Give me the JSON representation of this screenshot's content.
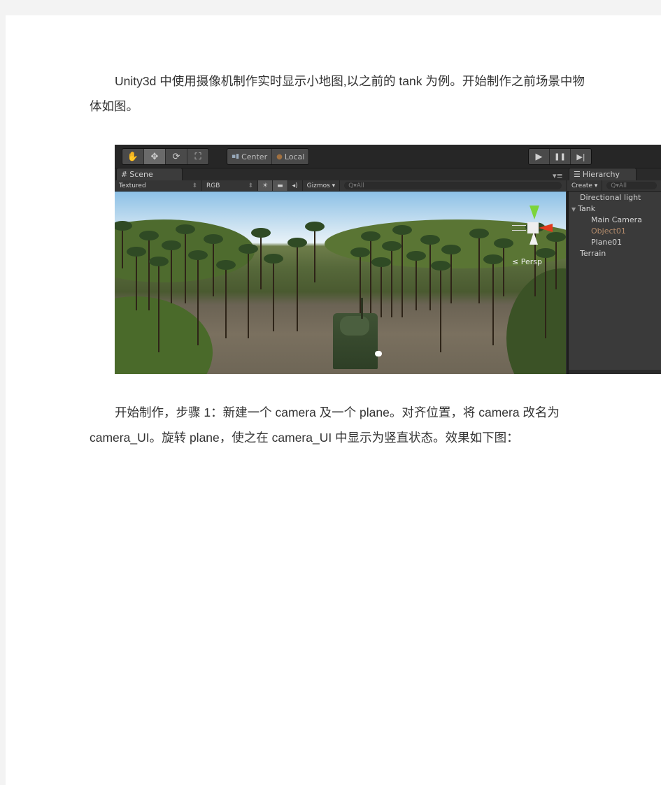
{
  "paragraphs": {
    "intro": "Unity3d 中使用摄像机制作实时显示小地图,以之前的 tank 为例。开始制作之前场景中物体如图。",
    "step1": "开始制作，步骤 1：新建一个 camera 及一个 plane。对齐位置，将 camera 改名为 camera_UI。旋转 plane，使之在 camera_UI 中显示为竖直状态。效果如下图："
  },
  "unity": {
    "toolbar": {
      "transform_tools": [
        {
          "name": "hand-tool",
          "glyph": "✋"
        },
        {
          "name": "move-tool",
          "glyph": "✥"
        },
        {
          "name": "rotate-tool",
          "glyph": "⟳"
        },
        {
          "name": "scale-tool",
          "glyph": "⛶"
        }
      ],
      "pivot_mode": "Center",
      "pivot_rotation": "Local",
      "play_controls": [
        {
          "name": "play",
          "glyph": "▶"
        },
        {
          "name": "pause",
          "glyph": "❚❚"
        },
        {
          "name": "step",
          "glyph": "▶|"
        }
      ]
    },
    "scene": {
      "tab_label": "Scene",
      "tab_icon": "#",
      "render_mode": "Textured",
      "channel": "RGB",
      "lighting_icon": "☀",
      "image_icon": "▬",
      "audio_icon": "◂)",
      "gizmos_label": "Gizmos ▾",
      "search_placeholder": "Q▾All",
      "menu_icon": "▾≡",
      "projection_label": "≤ Persp"
    },
    "hierarchy": {
      "tab_label": "Hierarchy",
      "tab_icon": "☰",
      "create_label": "Create ▾",
      "search_placeholder": "Q▾All",
      "items": [
        {
          "label": "Directional light",
          "depth": 0,
          "expanded": null,
          "selected": false
        },
        {
          "label": "Tank",
          "depth": 0,
          "expanded": true,
          "selected": false
        },
        {
          "label": "Main Camera",
          "depth": 1,
          "expanded": null,
          "selected": false
        },
        {
          "label": "Object01",
          "depth": 1,
          "expanded": null,
          "selected": true
        },
        {
          "label": "Plane01",
          "depth": 1,
          "expanded": null,
          "selected": false
        },
        {
          "label": "Terrain",
          "depth": 0,
          "expanded": null,
          "selected": false
        }
      ]
    }
  }
}
